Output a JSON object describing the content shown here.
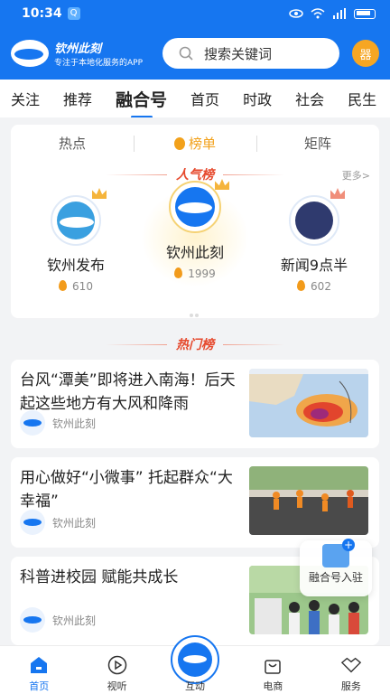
{
  "status_bar": {
    "time": "10:34"
  },
  "header": {
    "logo_title": "钦州此刻",
    "logo_subtitle": "专注于本地化服务的APP",
    "search_placeholder": "搜索关键词",
    "avatar_label": "器"
  },
  "tabs": [
    "关注",
    "推荐",
    "融合号",
    "首页",
    "时政",
    "社会",
    "民生"
  ],
  "active_tab_index": 2,
  "subtabs": [
    "热点",
    "榜单",
    "矩阵"
  ],
  "active_subtab_index": 1,
  "popularity": {
    "title": "人气榜",
    "more": "更多>",
    "accounts": [
      {
        "name": "钦州发布",
        "count": "610"
      },
      {
        "name": "钦州此刻",
        "count": "1999"
      },
      {
        "name": "新闻9点半",
        "count": "602"
      }
    ]
  },
  "hot_list": {
    "title": "热门榜",
    "items": [
      {
        "title": "台风“潭美”即将进入南海！后天起这些地方有大风和降雨",
        "source": "钦州此刻"
      },
      {
        "title": "用心做好“小微事” 托起群众“大幸福”",
        "source": "钦州此刻"
      },
      {
        "title": "科普进校园 赋能共成长",
        "source": "钦州此刻"
      }
    ]
  },
  "fab": {
    "label": "融合号入驻"
  },
  "bottom_nav": [
    "首页",
    "视听",
    "互动",
    "电商",
    "服务"
  ],
  "colors": {
    "brand": "#1676f0",
    "accent": "#f2a11b",
    "hot_red": "#e64a2e"
  }
}
